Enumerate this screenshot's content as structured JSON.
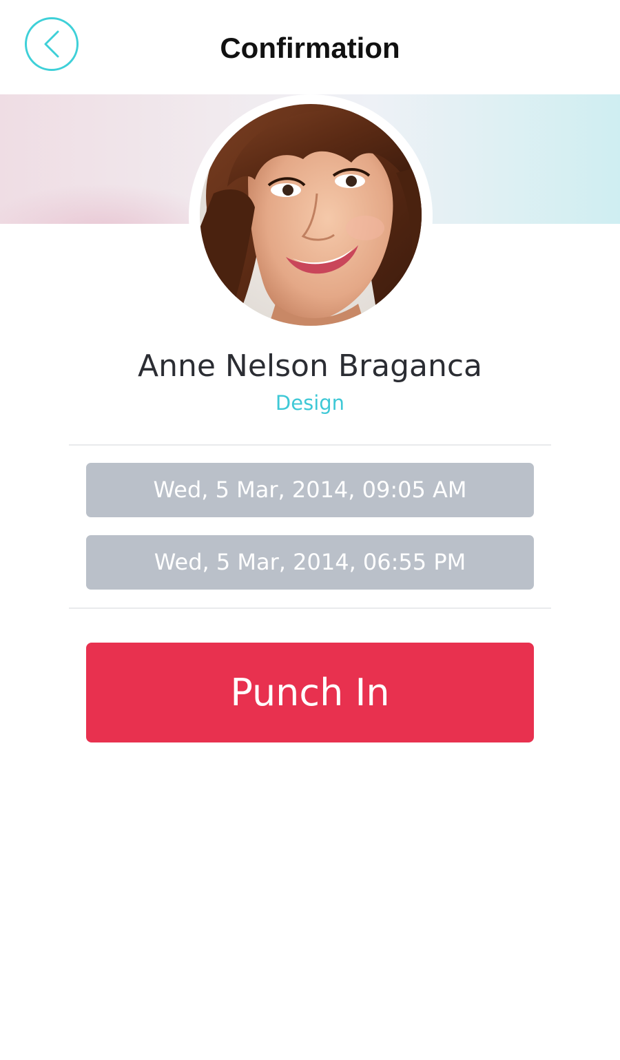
{
  "header": {
    "title": "Confirmation",
    "back_icon": "chevron-left-icon"
  },
  "profile": {
    "name": "Anne Nelson Braganca",
    "department": "Design",
    "avatar": "profile-photo"
  },
  "punch": {
    "start_time": "Wed, 5 Mar, 2014, 09:05 AM",
    "end_time": "Wed, 5 Mar, 2014, 06:55 PM",
    "button_label": "Punch In"
  },
  "colors": {
    "accent": "#3ed0d8",
    "primary_button": "#e8314f",
    "time_field": "#bac0c9"
  }
}
